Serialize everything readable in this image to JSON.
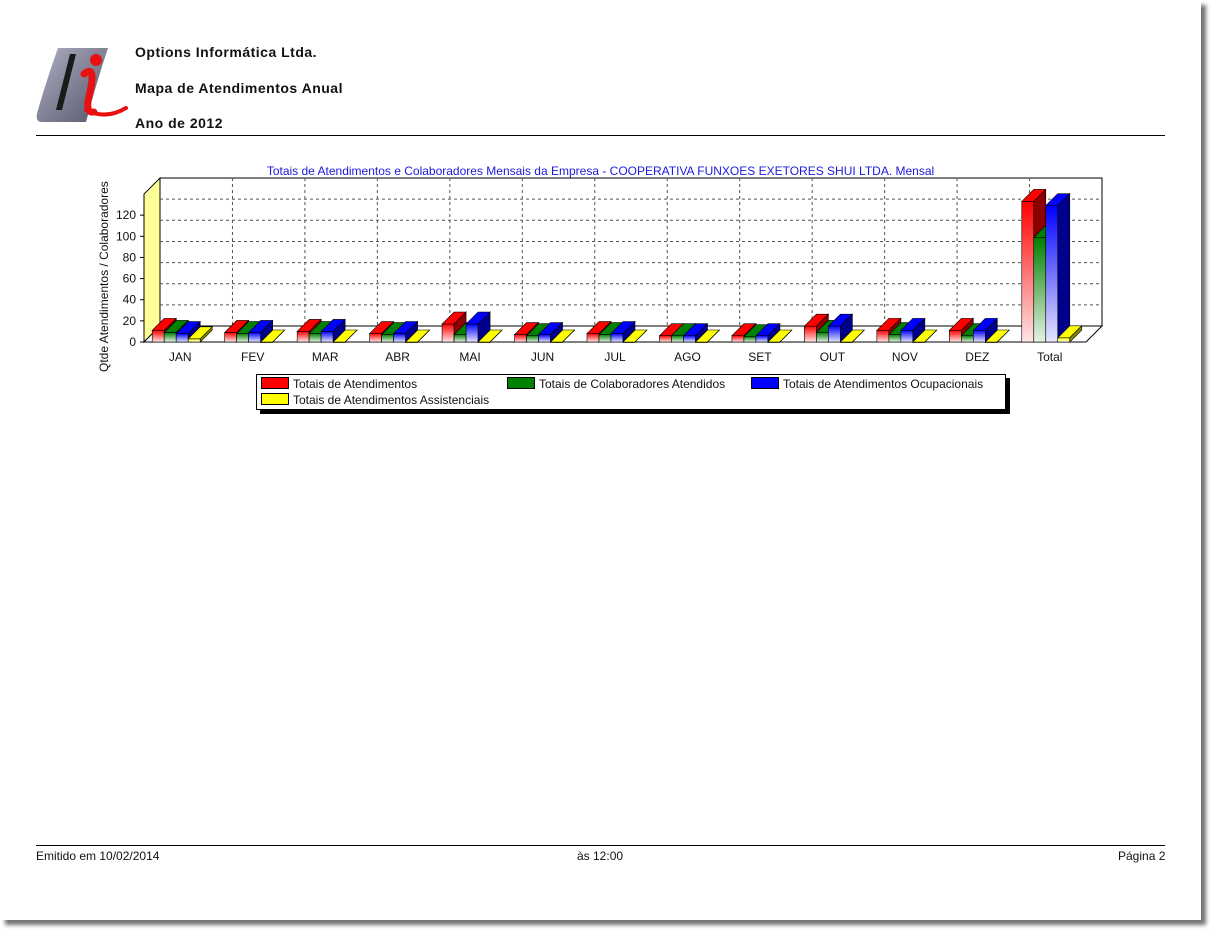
{
  "header": {
    "company": "Options Informática Ltda.",
    "report_title": "Mapa de Atendimentos Anual",
    "year_label": "Ano de 2012"
  },
  "chart_data": {
    "type": "bar",
    "title": "Totais de Atendimentos e Colaboradores Mensais da Empresa - COOPERATIVA FUNXOES EXETORES SHUI LTDA. Mensal",
    "ylabel": "Qtde Atendimentos / Colaboradores",
    "xlabel": "",
    "ylim": [
      0,
      140
    ],
    "yticks": [
      0,
      20,
      40,
      60,
      80,
      100,
      120
    ],
    "grid": true,
    "legend_position": "bottom",
    "categories": [
      "JAN",
      "FEV",
      "MAR",
      "ABR",
      "MAI",
      "JUN",
      "JUL",
      "AGO",
      "SET",
      "OUT",
      "NOV",
      "DEZ",
      "Total"
    ],
    "series": [
      {
        "name": "Totais de Atendimentos",
        "color": "#ff0000",
        "values": [
          11,
          9,
          10,
          8,
          17,
          7,
          8,
          6,
          6,
          15,
          11,
          11,
          133
        ]
      },
      {
        "name": "Totais de Colaboradores Atendidos",
        "color": "#008000",
        "values": [
          9,
          8,
          8,
          7,
          7,
          6,
          7,
          6,
          5,
          9,
          7,
          6,
          99
        ]
      },
      {
        "name": "Totais de Atendimentos Ocupacionais",
        "color": "#0000ff",
        "values": [
          8,
          9,
          10,
          8,
          17,
          7,
          8,
          6,
          6,
          15,
          11,
          11,
          129
        ]
      },
      {
        "name": "Totais de Atendimentos Assistenciais",
        "color": "#ffff00",
        "values": [
          3,
          0,
          0,
          0,
          0,
          0,
          0,
          0,
          0,
          0,
          0,
          0,
          4
        ]
      }
    ]
  },
  "footer": {
    "issued": "Emitido em 10/02/2014",
    "time": "às 12:00",
    "page": "Página 2"
  }
}
